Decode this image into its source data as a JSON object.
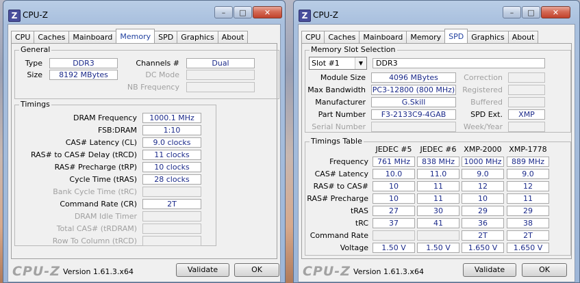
{
  "app": {
    "title": "CPU-Z",
    "brand": "CPU-Z",
    "version": "Version 1.61.3.x64",
    "validate_label": "Validate",
    "ok_label": "OK",
    "minimize_glyph": "–",
    "maximize_glyph": "□",
    "close_glyph": "✕",
    "icon_letter": "Z",
    "tabs": [
      "CPU",
      "Caches",
      "Mainboard",
      "Memory",
      "SPD",
      "Graphics",
      "About"
    ]
  },
  "memory": {
    "general": {
      "title": "General",
      "type_label": "Type",
      "type_value": "DDR3",
      "size_label": "Size",
      "size_value": "8192 MBytes",
      "channels_label": "Channels #",
      "channels_value": "Dual",
      "dcmode_label": "DC Mode",
      "dcmode_value": "",
      "nbfreq_label": "NB Frequency",
      "nbfreq_value": ""
    },
    "timings": {
      "title": "Timings",
      "rows": [
        {
          "label": "DRAM Frequency",
          "value": "1000.1 MHz",
          "disabled": false
        },
        {
          "label": "FSB:DRAM",
          "value": "1:10",
          "disabled": false
        },
        {
          "label": "CAS# Latency (CL)",
          "value": "9.0 clocks",
          "disabled": false
        },
        {
          "label": "RAS# to CAS# Delay (tRCD)",
          "value": "11 clocks",
          "disabled": false
        },
        {
          "label": "RAS# Precharge (tRP)",
          "value": "10 clocks",
          "disabled": false
        },
        {
          "label": "Cycle Time (tRAS)",
          "value": "28 clocks",
          "disabled": false
        },
        {
          "label": "Bank Cycle Time (tRC)",
          "value": "",
          "disabled": true
        },
        {
          "label": "Command Rate (CR)",
          "value": "2T",
          "disabled": false
        },
        {
          "label": "DRAM Idle Timer",
          "value": "",
          "disabled": true
        },
        {
          "label": "Total CAS# (tRDRAM)",
          "value": "",
          "disabled": true
        },
        {
          "label": "Row To Column (tRCD)",
          "value": "",
          "disabled": true
        }
      ]
    }
  },
  "spd": {
    "slot": {
      "title": "Memory Slot Selection",
      "selected": "Slot #1",
      "type": "DDR3",
      "module_size_label": "Module Size",
      "module_size": "4096 MBytes",
      "max_bw_label": "Max Bandwidth",
      "max_bw": "PC3-12800 (800 MHz)",
      "manufacturer_label": "Manufacturer",
      "manufacturer": "G.Skill",
      "part_label": "Part Number",
      "part": "F3-2133C9-4GAB",
      "serial_label": "Serial Number",
      "serial": "",
      "correction_label": "Correction",
      "correction": "",
      "registered_label": "Registered",
      "registered": "",
      "buffered_label": "Buffered",
      "buffered": "",
      "spdext_label": "SPD Ext.",
      "spdext": "XMP",
      "weekyear_label": "Week/Year",
      "weekyear": ""
    },
    "timings_table": {
      "title": "Timings Table",
      "columns": [
        "JEDEC #5",
        "JEDEC #6",
        "XMP-2000",
        "XMP-1778"
      ],
      "rows": [
        {
          "label": "Frequency",
          "values": [
            "761 MHz",
            "838 MHz",
            "1000 MHz",
            "889 MHz"
          ]
        },
        {
          "label": "CAS# Latency",
          "values": [
            "10.0",
            "11.0",
            "9.0",
            "9.0"
          ]
        },
        {
          "label": "RAS# to CAS#",
          "values": [
            "10",
            "11",
            "12",
            "12"
          ]
        },
        {
          "label": "RAS# Precharge",
          "values": [
            "10",
            "11",
            "10",
            "11"
          ]
        },
        {
          "label": "tRAS",
          "values": [
            "27",
            "30",
            "29",
            "29"
          ]
        },
        {
          "label": "tRC",
          "values": [
            "37",
            "41",
            "36",
            "38"
          ]
        },
        {
          "label": "Command Rate",
          "values": [
            "",
            "",
            "2T",
            "2T"
          ]
        },
        {
          "label": "Voltage",
          "values": [
            "1.50 V",
            "1.50 V",
            "1.650 V",
            "1.650 V"
          ]
        }
      ]
    }
  }
}
